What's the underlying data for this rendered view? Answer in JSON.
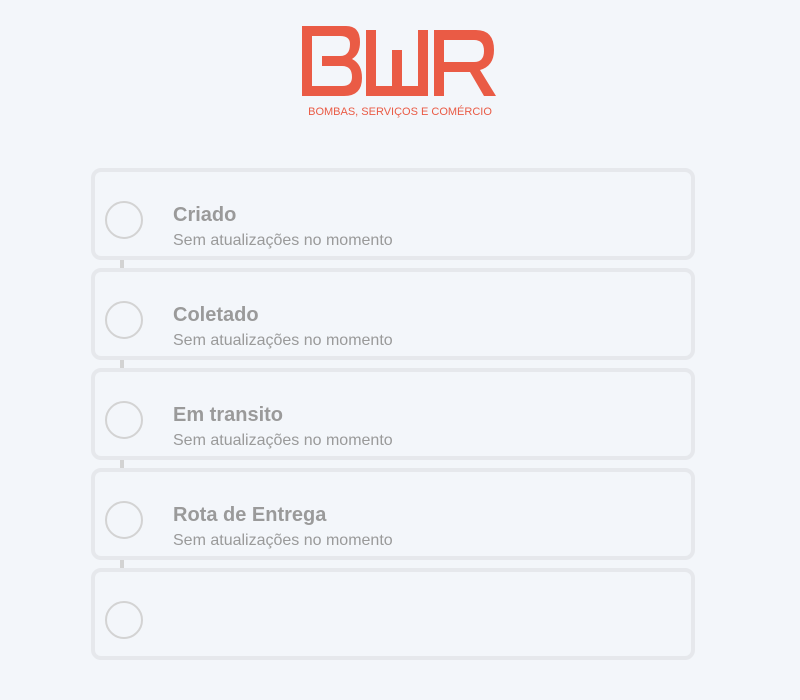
{
  "header": {
    "logo_text": "BWR",
    "logo_tagline": "BOMBAS, SERVIÇOS E COMÉRCIO",
    "brand_color": "#ea5b45"
  },
  "timeline": {
    "steps": [
      {
        "title": "Criado",
        "status": "Sem atualizações no momento"
      },
      {
        "title": "Coletado",
        "status": "Sem atualizações no momento"
      },
      {
        "title": "Em transito",
        "status": "Sem atualizações no momento"
      },
      {
        "title": "Rota de Entrega",
        "status": "Sem atualizações no momento"
      },
      {
        "title": "",
        "status": ""
      }
    ]
  }
}
